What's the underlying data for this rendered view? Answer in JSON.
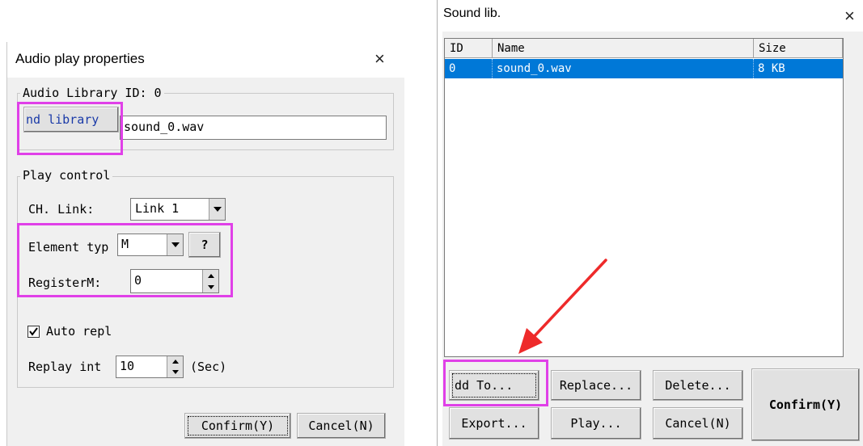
{
  "left_dialog": {
    "title": "Audio play properties",
    "close_symbol": "×",
    "audio_group": {
      "legend": "Audio Library ID: 0",
      "library_button": "nd library",
      "file_value": "sound_0.wav"
    },
    "play_group": {
      "legend": "Play control",
      "ch_link_label": "CH. Link:",
      "ch_link_value": "Link 1",
      "element_type_label": "Element typ",
      "element_type_value": "M",
      "help_button": "?",
      "register_label": "RegisterM:",
      "register_value": "0",
      "auto_replay_label": "Auto repl",
      "auto_replay_checked": true,
      "replay_interval_label": "Replay int",
      "replay_interval_value": "10",
      "replay_unit": "(Sec)"
    },
    "confirm_button": "Confirm(Y)",
    "cancel_button": "Cancel(N)"
  },
  "right_dialog": {
    "title": "Sound lib.",
    "close_symbol": "×",
    "columns": [
      "ID",
      "Name",
      "Size"
    ],
    "rows": [
      {
        "id": "0",
        "name": "sound_0.wav",
        "size": "8 KB",
        "selected": true
      }
    ],
    "buttons": {
      "add_to": "dd To...",
      "replace": "Replace...",
      "delete": "Delete...",
      "export": "Export...",
      "play": "Play...",
      "cancel": "Cancel(N)",
      "confirm": "Confirm(Y)"
    }
  },
  "colors": {
    "highlight": "#e040e8",
    "arrow": "#ee2a2a",
    "selection": "#0078d7"
  }
}
